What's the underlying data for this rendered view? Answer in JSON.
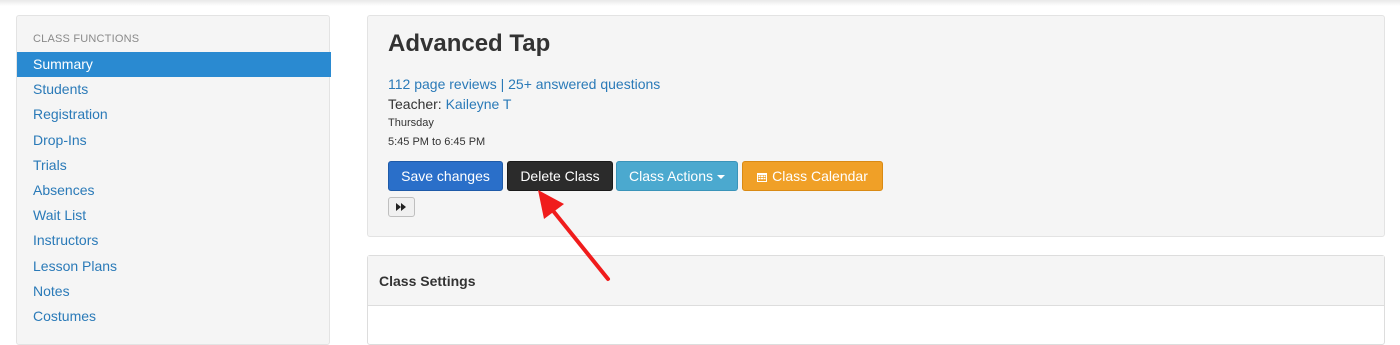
{
  "sidebar": {
    "header": "CLASS FUNCTIONS",
    "items": [
      {
        "label": "Summary"
      },
      {
        "label": "Students"
      },
      {
        "label": "Registration"
      },
      {
        "label": "Drop-Ins"
      },
      {
        "label": "Trials"
      },
      {
        "label": "Absences"
      },
      {
        "label": "Wait List"
      },
      {
        "label": "Instructors"
      },
      {
        "label": "Lesson Plans"
      },
      {
        "label": "Notes"
      },
      {
        "label": "Costumes"
      }
    ],
    "active_item": "Summary"
  },
  "class": {
    "title": "Advanced Tap",
    "reviews_link": "112 page reviews",
    "separator": " | ",
    "questions_link": "25+ answered questions",
    "teacher_label": "Teacher: ",
    "teacher_name": "Kaileyne T",
    "day": "Thursday",
    "time": "5:45 PM to 6:45 PM"
  },
  "buttons": {
    "save": "Save changes",
    "delete": "Delete Class",
    "actions": "Class Actions",
    "calendar": "Class Calendar",
    "forward_icon": "fast-forward-icon"
  },
  "settings": {
    "title": "Class Settings"
  },
  "colors": {
    "link": "#2a7ab8",
    "active": "#2a8ad1",
    "save": "#2a6fc9",
    "delete": "#2b2b2b",
    "actions": "#4ba9cf",
    "calendar": "#f0a027",
    "annotation_arrow": "#f01c1c"
  }
}
